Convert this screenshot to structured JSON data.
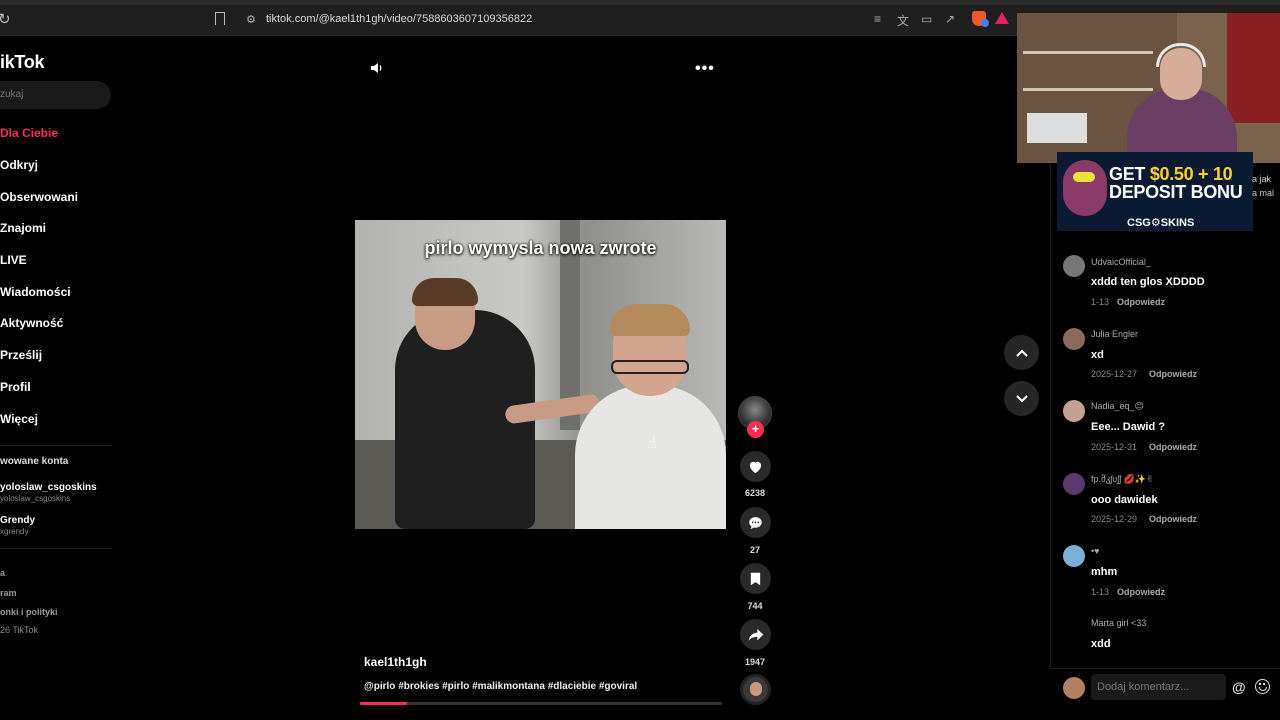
{
  "browser": {
    "url": "tiktok.com/@kael1th1gh/video/7588603607109356822"
  },
  "sidebar": {
    "logo": "ikTok",
    "search_placeholder": "zukaj",
    "nav": [
      {
        "label": "Dla Ciebie",
        "active": true
      },
      {
        "label": "Odkryj"
      },
      {
        "label": "Obserwowani"
      },
      {
        "label": "Znajomi"
      },
      {
        "label": "LIVE"
      },
      {
        "label": "Wiadomości"
      },
      {
        "label": "Aktywność"
      },
      {
        "label": "Prześlij"
      },
      {
        "label": "Profil"
      },
      {
        "label": "Więcej"
      }
    ],
    "followed_title": "wowane konta",
    "followed": [
      {
        "name": "yoloslaw_csgoskins",
        "handle": "yoloslaw_csgoskins"
      },
      {
        "name": "Grendy",
        "handle": "xgrendy"
      }
    ],
    "footer": [
      "a",
      "ram",
      "onki i polityki",
      "26 TikTok"
    ]
  },
  "video": {
    "overlay_caption": "pirlo wymysla nowa zwrote",
    "author": "kael1th1gh",
    "description": "@pirlo #brokies #pirlo #malikmontana #dlaciebie #goviral",
    "progress": 0.13,
    "more_label": "•••"
  },
  "actions": {
    "likes": "6238",
    "comments": "27",
    "saves": "744",
    "shares": "1947",
    "follow_label": "+"
  },
  "ad": {
    "line1_prefix": "GET ",
    "line1_accent": "$0.50 + 10",
    "line2": "DEPOSIT BONU",
    "brand": "CSG⚙SKINS",
    "overflow_1": "a jak",
    "overflow_2": "a mal"
  },
  "comments": {
    "reply_label": "Odpowiedz",
    "items": [
      {
        "user": "UdvaicOfficial_",
        "text": "xddd ten glos XDDDD",
        "date": "1-13"
      },
      {
        "user": "Julia Engler",
        "text": "xd",
        "date": "2025-12-27"
      },
      {
        "user": "Nadia_eq_😊",
        "text": "Eee... Dawid ?",
        "date": "2025-12-31"
      },
      {
        "user": "fp.მკʃυʃʃ 💋✨✌",
        "text": "ooo dawidek",
        "date": "2025-12-29"
      },
      {
        "user": "•♥",
        "text": "mhm",
        "date": "1-13"
      },
      {
        "user": "Marta girl <33",
        "text": "xdd",
        "date": ""
      }
    ],
    "input_placeholder": "Dodaj komentarz...",
    "at_label": "@"
  },
  "colors": {
    "accent": "#fe2c55",
    "background": "#000000"
  }
}
